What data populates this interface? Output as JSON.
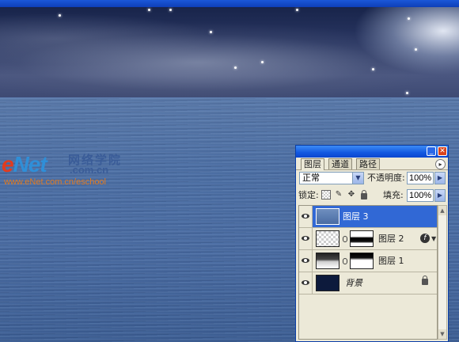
{
  "watermark": {
    "brand_e": "e",
    "brand_net": "Net",
    "chinese": "网络学院",
    "domain": ".com.cn",
    "url": "www.eNet.com.cn/eschool"
  },
  "layers_panel": {
    "tabs": [
      {
        "label": "图层",
        "active": true
      },
      {
        "label": "通道",
        "active": false
      },
      {
        "label": "路径",
        "active": false
      }
    ],
    "blend_mode": "正常",
    "opacity_label": "不透明度:",
    "opacity_value": "100%",
    "lock_label": "锁定:",
    "fill_label": "填充:",
    "fill_value": "100%",
    "layers": [
      {
        "name": "图层 3",
        "selected": true,
        "visible": true,
        "thumbnail": "blue-sea"
      },
      {
        "name": "图层 2",
        "selected": false,
        "visible": true,
        "thumbnail": "transparent-with-mask",
        "has_effects": true
      },
      {
        "name": "图层 1",
        "selected": false,
        "visible": true,
        "thumbnail": "dark-with-mask"
      },
      {
        "name": "背景",
        "selected": false,
        "visible": true,
        "thumbnail": "dark-navy",
        "locked": true
      }
    ],
    "colors": {
      "selection": "#3168d5",
      "titlebar": "#1257e0",
      "panel_bg": "#ece9d8"
    }
  }
}
